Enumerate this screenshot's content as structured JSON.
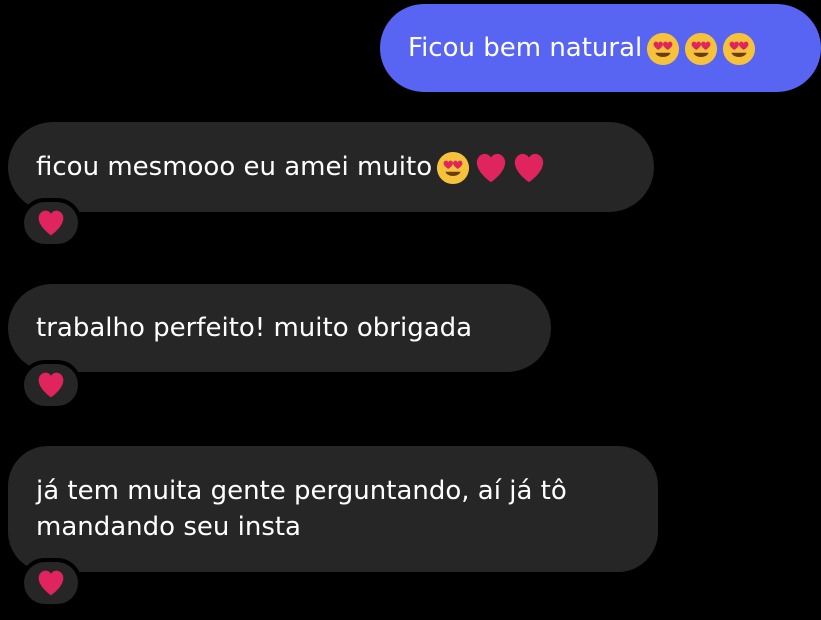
{
  "conversation": {
    "messages": [
      {
        "direction": "sent",
        "text": "Ficou bem natural",
        "emojis": [
          "heart-eyes-emoji",
          "heart-eyes-emoji",
          "heart-eyes-emoji"
        ]
      },
      {
        "direction": "received",
        "text": "ficou mesmooo eu amei muito",
        "emojis": [
          "heart-eyes-emoji",
          "red-heart-emoji",
          "red-heart-emoji"
        ],
        "reaction": "red-heart-emoji"
      },
      {
        "direction": "received",
        "text": "trabalho perfeito! muito obrigada",
        "reaction": "red-heart-emoji"
      },
      {
        "direction": "received",
        "lines": [
          "já tem muita gente perguntando, aí já tô",
          "mandando seu insta"
        ],
        "reaction": "red-heart-emoji"
      }
    ]
  },
  "colors": {
    "background": "#000000",
    "sent_bubble": "#5865f2",
    "received_bubble": "#262626",
    "text": "#ffffff",
    "heart": "#e0245e"
  }
}
